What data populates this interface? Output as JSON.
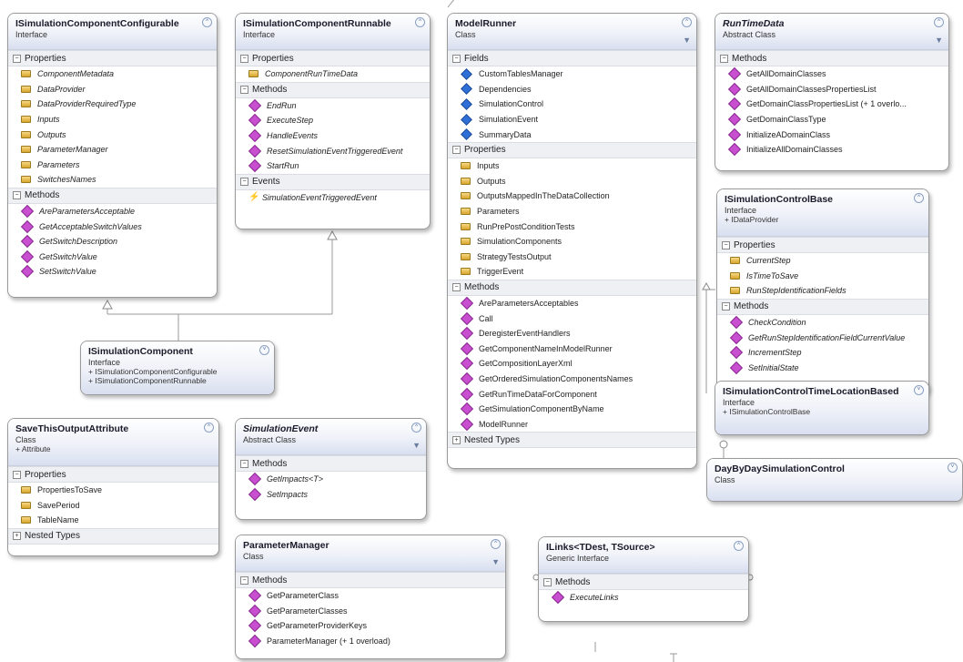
{
  "boxes": {
    "configurable": {
      "title": "ISimulationComponentConfigurable",
      "kind": "Interface",
      "sections": [
        {
          "label": "Properties",
          "members": [
            "ComponentMetadata",
            "DataProvider",
            "DataProviderRequiredType",
            "Inputs",
            "Outputs",
            "ParameterManager",
            "Parameters",
            "SwitchesNames"
          ]
        },
        {
          "label": "Methods",
          "members": [
            "AreParametersAcceptable",
            "GetAcceptableSwitchValues",
            "GetSwitchDescription",
            "GetSwitchValue",
            "SetSwitchValue"
          ]
        }
      ]
    },
    "runnable": {
      "title": "ISimulationComponentRunnable",
      "kind": "Interface",
      "sections": [
        {
          "label": "Properties",
          "members": [
            "ComponentRunTimeData"
          ]
        },
        {
          "label": "Methods",
          "members": [
            "EndRun",
            "ExecuteStep",
            "HandleEvents",
            "ResetSimulationEventTriggeredEvent",
            "StartRun"
          ]
        },
        {
          "label": "Events",
          "members": [
            "SimulationEventTriggeredEvent"
          ]
        }
      ]
    },
    "modelrunner": {
      "title": "ModelRunner",
      "kind": "Class",
      "sections": [
        {
          "label": "Fields",
          "members": [
            "CustomTablesManager",
            "Dependencies",
            "SimulationControl",
            "SimulationEvent",
            "SummaryData"
          ]
        },
        {
          "label": "Properties",
          "members": [
            "Inputs",
            "Outputs",
            "OutputsMappedInTheDataCollection",
            "Parameters",
            "RunPrePostConditionTests",
            "SimulationComponents",
            "StrategyTestsOutput",
            "TriggerEvent"
          ]
        },
        {
          "label": "Methods",
          "members": [
            "AreParametersAcceptables",
            "Call",
            "DeregisterEventHandlers",
            "GetComponentNameInModelRunner",
            "GetCompositionLayerXml",
            "GetOrderedSimulationComponentsNames",
            "GetRunTimeDataForComponent",
            "GetSimulationComponentByName",
            "ModelRunner"
          ]
        },
        {
          "label": "Nested Types",
          "members": []
        }
      ]
    },
    "runtimedata": {
      "title": "RunTimeData",
      "kind": "Abstract Class",
      "sections": [
        {
          "label": "Methods",
          "members": [
            "GetAllDomainClasses",
            "GetAllDomainClassesPropertiesList",
            "GetDomainClassPropertiesList (+ 1 overlo...",
            "GetDomainClassType",
            "InitializeADomainClass",
            "InitializeAllDomainClasses"
          ]
        }
      ]
    },
    "controlbase": {
      "title": "ISimulationControlBase",
      "kind": "Interface",
      "inherits": [
        "IDataProvider"
      ],
      "sections": [
        {
          "label": "Properties",
          "members": [
            "CurrentStep",
            "IsTimeToSave",
            "RunStepIdentificationFields"
          ]
        },
        {
          "label": "Methods",
          "members": [
            "CheckCondition",
            "GetRunStepIdentificationFieldCurrentValue",
            "IncrementStep",
            "SetInitialState"
          ]
        }
      ]
    },
    "timelocation": {
      "title": "ISimulationControlTimeLocationBased",
      "kind": "Interface",
      "inherits": [
        "ISimulationControlBase"
      ],
      "sections": []
    },
    "component": {
      "title": "ISimulationComponent",
      "kind": "Interface",
      "inherits": [
        "ISimulationComponentConfigurable",
        "ISimulationComponentRunnable"
      ],
      "sections": []
    },
    "saveattr": {
      "title": "SaveThisOutputAttribute",
      "kind": "Class",
      "inherits": [
        "Attribute"
      ],
      "sections": [
        {
          "label": "Properties",
          "members": [
            "PropertiesToSave",
            "SavePeriod",
            "TableName"
          ]
        },
        {
          "label": "Nested Types",
          "members": []
        }
      ]
    },
    "simevent": {
      "title": "SimulationEvent",
      "kind": "Abstract Class",
      "sections": [
        {
          "label": "Methods",
          "members": [
            "GetImpacts<T>",
            "SetImpacts"
          ]
        }
      ]
    },
    "parammanager": {
      "title": "ParameterManager",
      "kind": "Class",
      "sections": [
        {
          "label": "Methods",
          "members": [
            "GetParameterClass",
            "GetParameterClasses",
            "GetParameterProviderKeys",
            "ParameterManager (+ 1 overload)"
          ]
        }
      ]
    },
    "ilinks": {
      "title": "ILinks<TDest, TSource>",
      "kind": "Generic Interface",
      "sections": [
        {
          "label": "Methods",
          "members": [
            "ExecuteLinks"
          ]
        }
      ]
    },
    "daybyday": {
      "title": "DayByDaySimulationControl",
      "kind": "Class",
      "sections": []
    }
  }
}
